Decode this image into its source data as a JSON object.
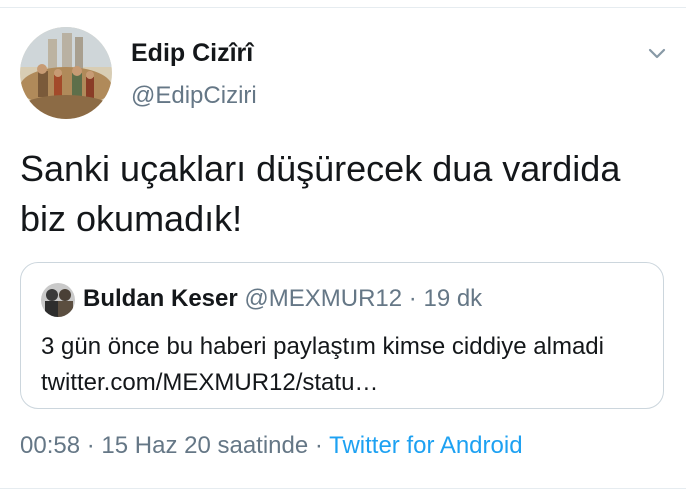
{
  "author": {
    "display_name": "Edip Cizîrî",
    "username": "@EdipCiziri"
  },
  "tweet": {
    "text": "Sanki uçakları düşürecek dua vardida biz okumadık!"
  },
  "quoted_tweet": {
    "display_name": "Buldan Keser",
    "handle": "@MEXMUR12",
    "separator": "·",
    "time": "19 dk",
    "text": "3 gün önce bu haberi paylaştım kimse ciddiye almadi twitter.com/MEXMUR12/statu…"
  },
  "meta": {
    "time": "00:58",
    "separator": "·",
    "date": "15 Haz 20 saatinde",
    "separator2": "·",
    "source": "Twitter for Android"
  },
  "icons": {
    "menu": "chevron-down-icon"
  },
  "colors": {
    "text": "#14171a",
    "secondary": "#657786",
    "link": "#1da1f2",
    "border": "#ccd6dd"
  }
}
